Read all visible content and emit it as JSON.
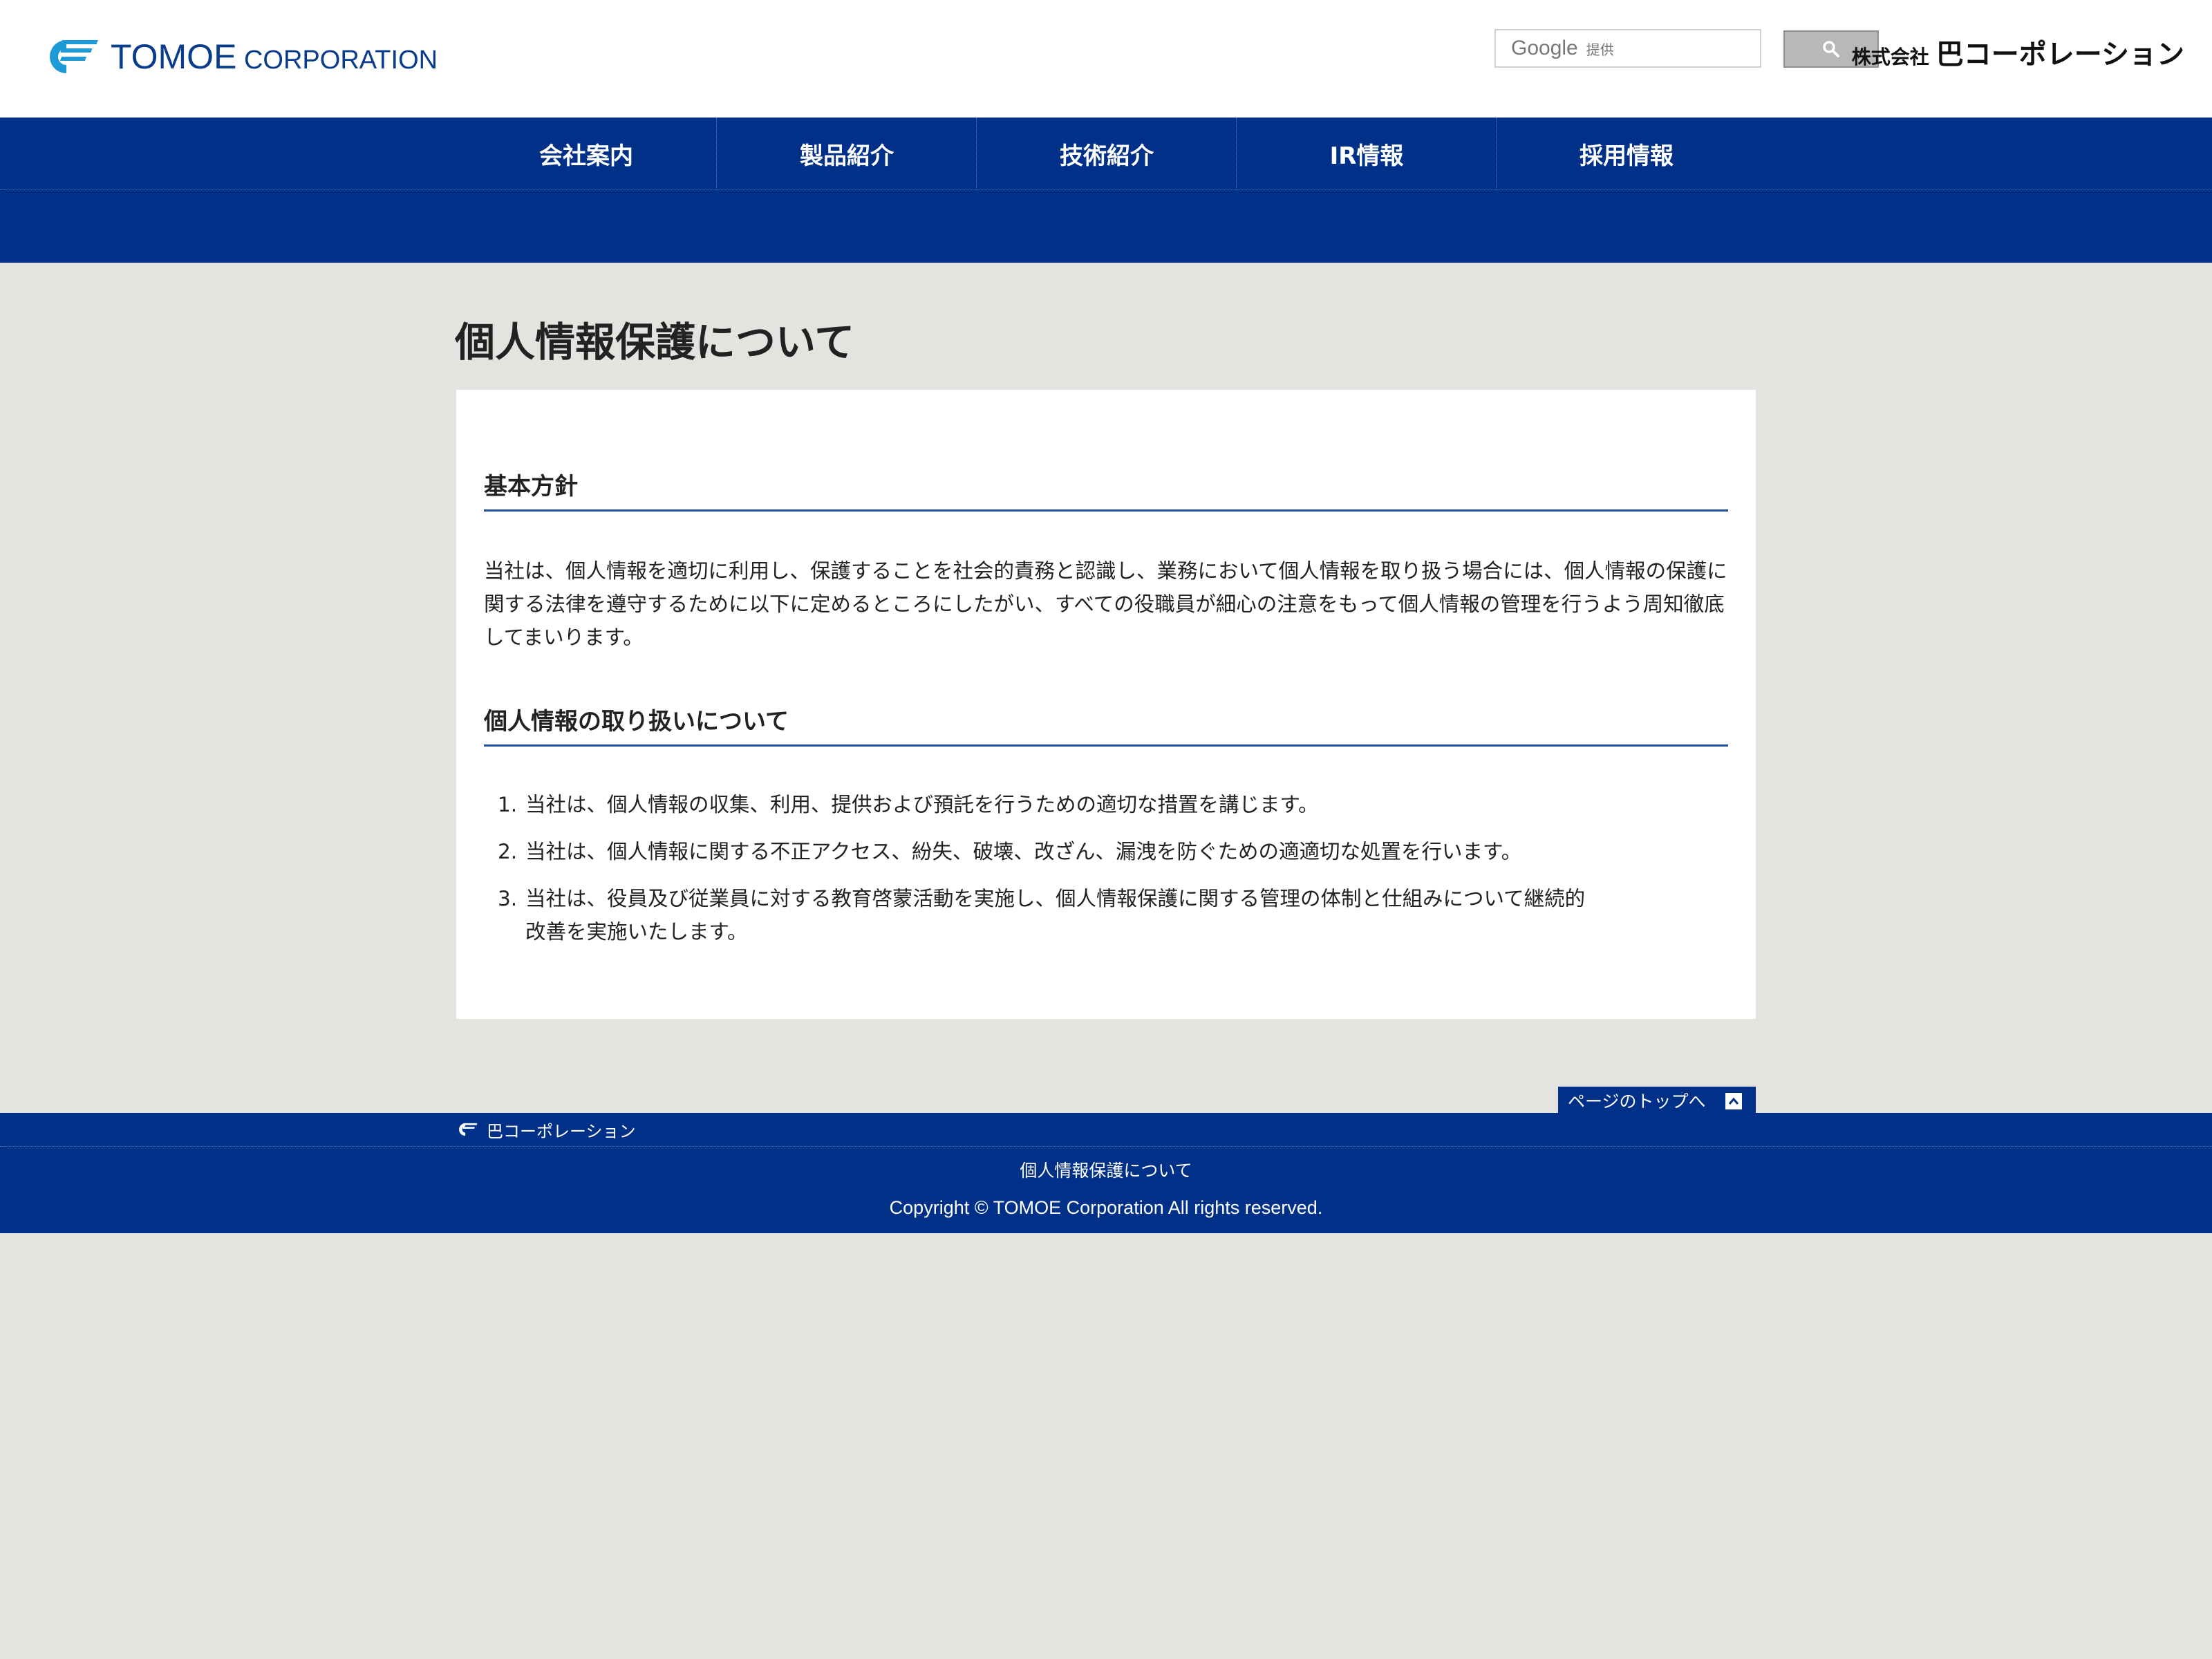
{
  "header": {
    "logo_main": "TOMOE",
    "logo_sub": " CORPORATION",
    "search_brand": "Google",
    "search_brand_suffix": "提供",
    "corp_prefix": "株式会社",
    "corp_name": "巴コーポレーション"
  },
  "nav": {
    "items": [
      {
        "label": "会社案内"
      },
      {
        "label": "製品紹介"
      },
      {
        "label": "技術紹介"
      },
      {
        "label": "IR情報"
      },
      {
        "label": "採用情報"
      }
    ]
  },
  "main": {
    "title": "個人情報保護について",
    "section1": {
      "heading": "基本方針",
      "body": "当社は、個人情報を適切に利用し、保護することを社会的責務と認識し、業務において個人情報を取り扱う場合には、個人情報の保護に関する法律を遵守するために以下に定めるところにしたがい、すべての役職員が細心の注意をもって個人情報の管理を行うよう周知徹底してまいります。"
    },
    "section2": {
      "heading": "個人情報の取り扱いについて",
      "items": [
        {
          "num": "1.",
          "text": "当社は、個人情報の収集、利用、提供および預託を行うための適切な措置を講じます。"
        },
        {
          "num": "2.",
          "text": "当社は、個人情報に関する不正アクセス、紛失、破壊、改ざん、漏洩を防ぐための適適切な処置を行います。"
        },
        {
          "num": "3.",
          "text": "当社は、役員及び従業員に対する教育啓蒙活動を実施し、個人情報保護に関する管理の体制と仕組みについて継続的改善を実施いたします。"
        }
      ]
    }
  },
  "footer": {
    "to_top": "ページのトップへ",
    "crumb_home": "巴コーポレーション",
    "link": "個人情報保護について",
    "copyright": "Copyright © TOMOE Corporation All rights reserved."
  },
  "colors": {
    "brand_blue": "#003087",
    "logo_blue": "#0a3c8c",
    "logo_cyan": "#1e9ad6",
    "background": "#e3e4e0"
  },
  "icons": {
    "search": "search-icon",
    "to_top": "chevron-up-icon",
    "logo": "tomoe-logo-mark"
  }
}
